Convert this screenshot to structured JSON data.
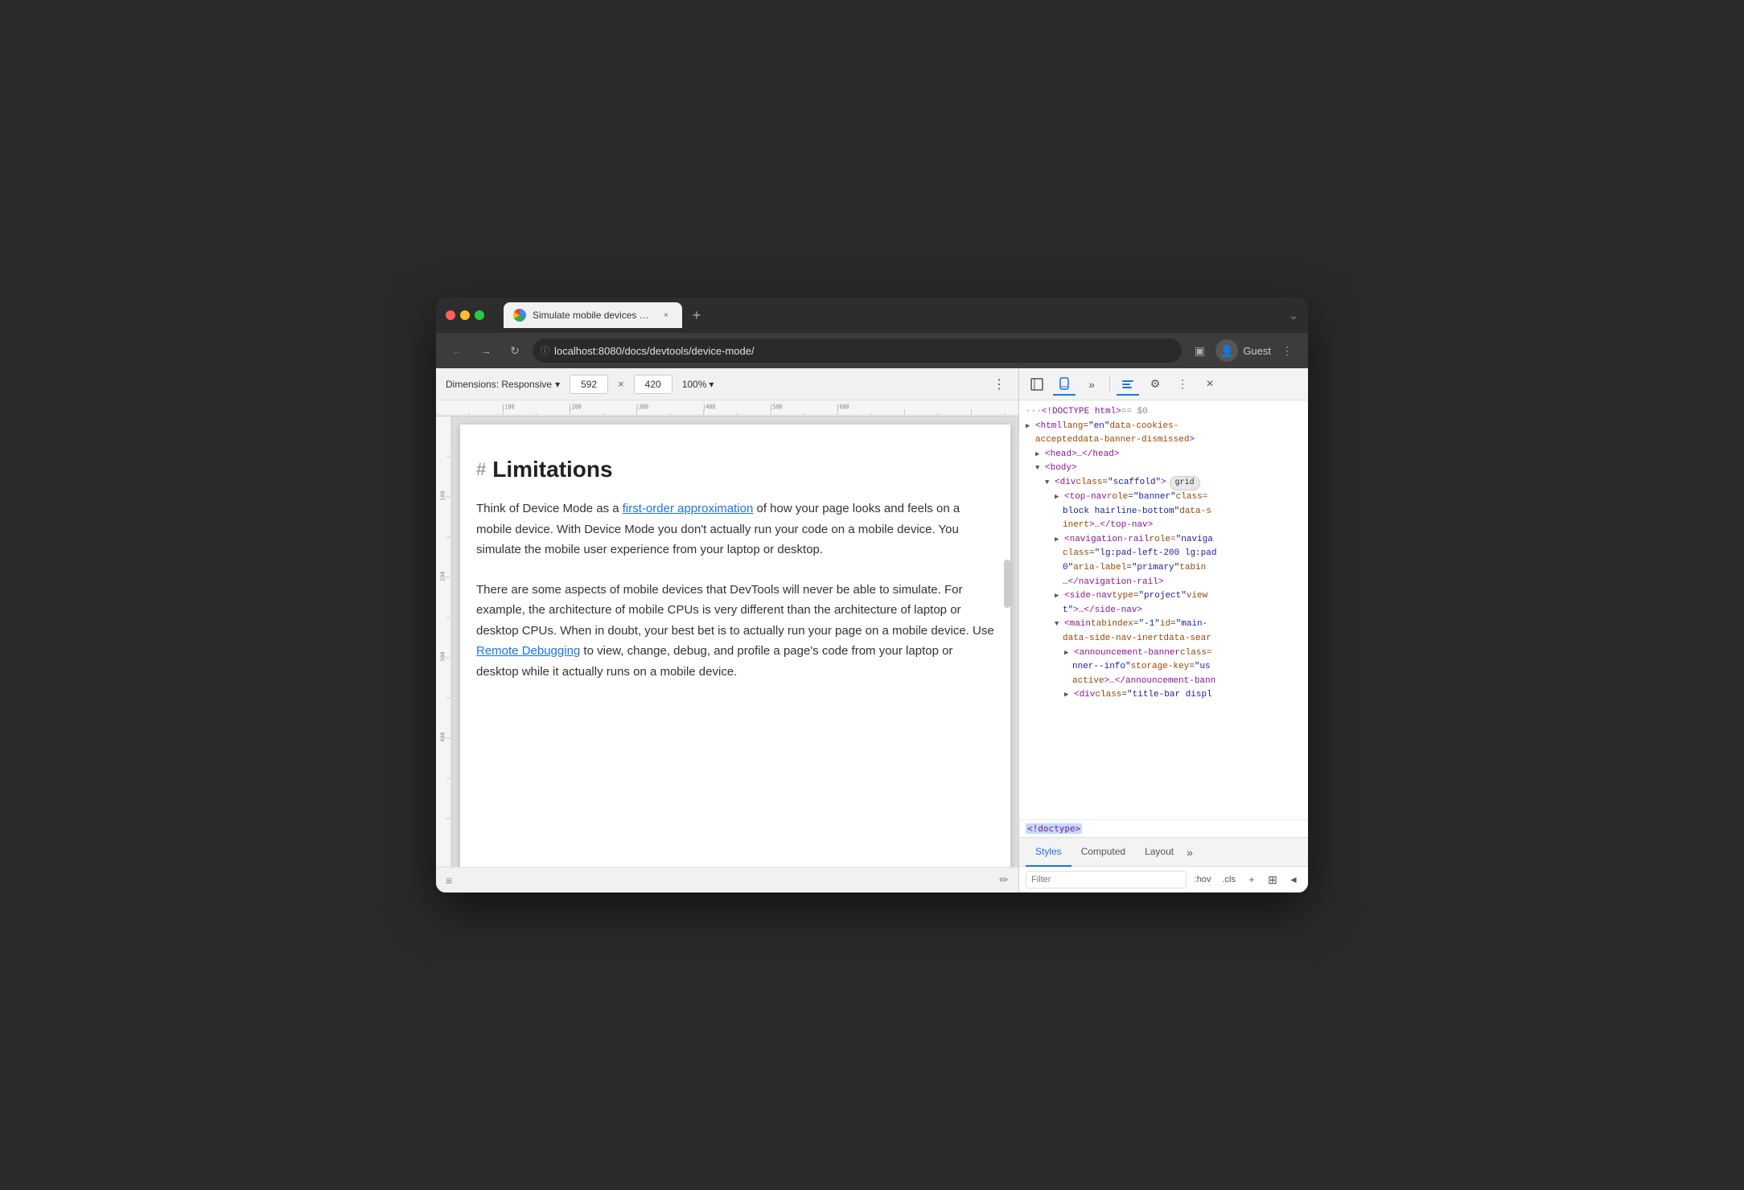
{
  "browser": {
    "title": "Simulate mobile devices with D",
    "tab_title": "Simulate mobile devices with D",
    "url": "localhost:8080/docs/devtools/device-mode/",
    "user": "Guest"
  },
  "device_toolbar": {
    "dimensions_label": "Dimensions: Responsive",
    "width_value": "592",
    "height_value": "420",
    "zoom_label": "100%",
    "dropdown_arrow": "▾"
  },
  "page": {
    "heading": "Limitations",
    "heading_anchor": "#",
    "para1": "Think of Device Mode as a ",
    "para1_link": "first-order approximation",
    "para1_rest": " of how your page looks and feels on a mobile device. With Device Mode you don't actually run your code on a mobile device. You simulate the mobile user experience from your laptop or desktop.",
    "para2_start": "There are some aspects of mobile devices that DevTools will never be able to simulate. For example, the architecture of mobile CPUs is very different than the architecture of laptop or desktop CPUs. When in doubt, your best bet is to actually run your page on a mobile device. Use ",
    "para2_link": "Remote Debugging",
    "para2_end": " to view, change, debug, and profile a page's code from your laptop or desktop while it actually runs on a mobile device."
  },
  "devtools": {
    "toolbar": {
      "inspect_label": "Inspect",
      "device_label": "Device",
      "more_label": "More",
      "console_label": "Console",
      "settings_label": "Settings",
      "more2_label": "More options",
      "close_label": "Close"
    },
    "code_header": "··· <!DOCTYPE html> == $0",
    "code_lines": [
      {
        "indent": 0,
        "text": "<html lang=\"en\" data-cookies-accepted data-banner-dismissed>",
        "expandable": true,
        "expand": "►"
      },
      {
        "indent": 1,
        "text": "►<head>…</head>",
        "expandable": true,
        "expand": "►"
      },
      {
        "indent": 1,
        "text": "▼<body>",
        "expandable": true,
        "expand": "▼"
      },
      {
        "indent": 2,
        "text": "▼<div class=\"scaffold\">",
        "badge": "grid",
        "expandable": true,
        "expand": "▼"
      },
      {
        "indent": 3,
        "text": "►<top-nav role=\"banner\" class=block hairline-bottom\" data-sinert>…</top-nav>",
        "expandable": true
      },
      {
        "indent": 3,
        "text": "►<navigation-rail role=\"naviga class=\"lg:pad-left-200 lg:pad 0\" aria-label=\"primary\" tabin …</navigation-rail>",
        "expandable": true
      },
      {
        "indent": 3,
        "text": "►<side-nav type=\"project\" view t\">…</side-nav>",
        "expandable": true
      },
      {
        "indent": 3,
        "text": "▼<main tabindex=\"-1\" id=\"main- data-side-nav-inert data-sear",
        "expandable": true,
        "expand": "▼"
      },
      {
        "indent": 4,
        "text": "►<announcement-banner class= nner--info\" storage-key=\"us active>…</announcement-bann",
        "expandable": true
      },
      {
        "indent": 4,
        "text": "►<div class=\"title-bar displ",
        "expandable": true
      }
    ],
    "doctype_line": "<!doctype>",
    "bottom_tabs": [
      "Styles",
      "Computed",
      "Layout"
    ],
    "active_tab": "Styles",
    "filter_placeholder": "Filter",
    "filter_hov": ":hov",
    "filter_cls": ".cls",
    "filter_plus": "+"
  },
  "icons": {
    "back": "←",
    "forward": "→",
    "reload": "↻",
    "lock": "ⓘ",
    "bookmark": "☆",
    "extensions": "⬛",
    "menu": "⋮",
    "sidebar": "▣",
    "close": "×",
    "plus": "+",
    "chevron_down": "⌄",
    "more_vert": "⋮",
    "inspect": "⬚",
    "device_toggle": "📱",
    "console_icon": "◫",
    "gear": "⚙",
    "expand_more": "»",
    "pen": "✏",
    "left_arrow": "◄"
  },
  "colors": {
    "accent_blue": "#1a73e8",
    "chrome_bg": "#2d2d2d",
    "nav_bg": "#3c3c3c",
    "toolbar_bg": "#f1f1f1",
    "devtools_bg": "#f3f3f3",
    "code_tag": "#881391",
    "code_attr": "#994500",
    "code_value": "#1a1aa6",
    "link_color": "#1a73e8"
  }
}
